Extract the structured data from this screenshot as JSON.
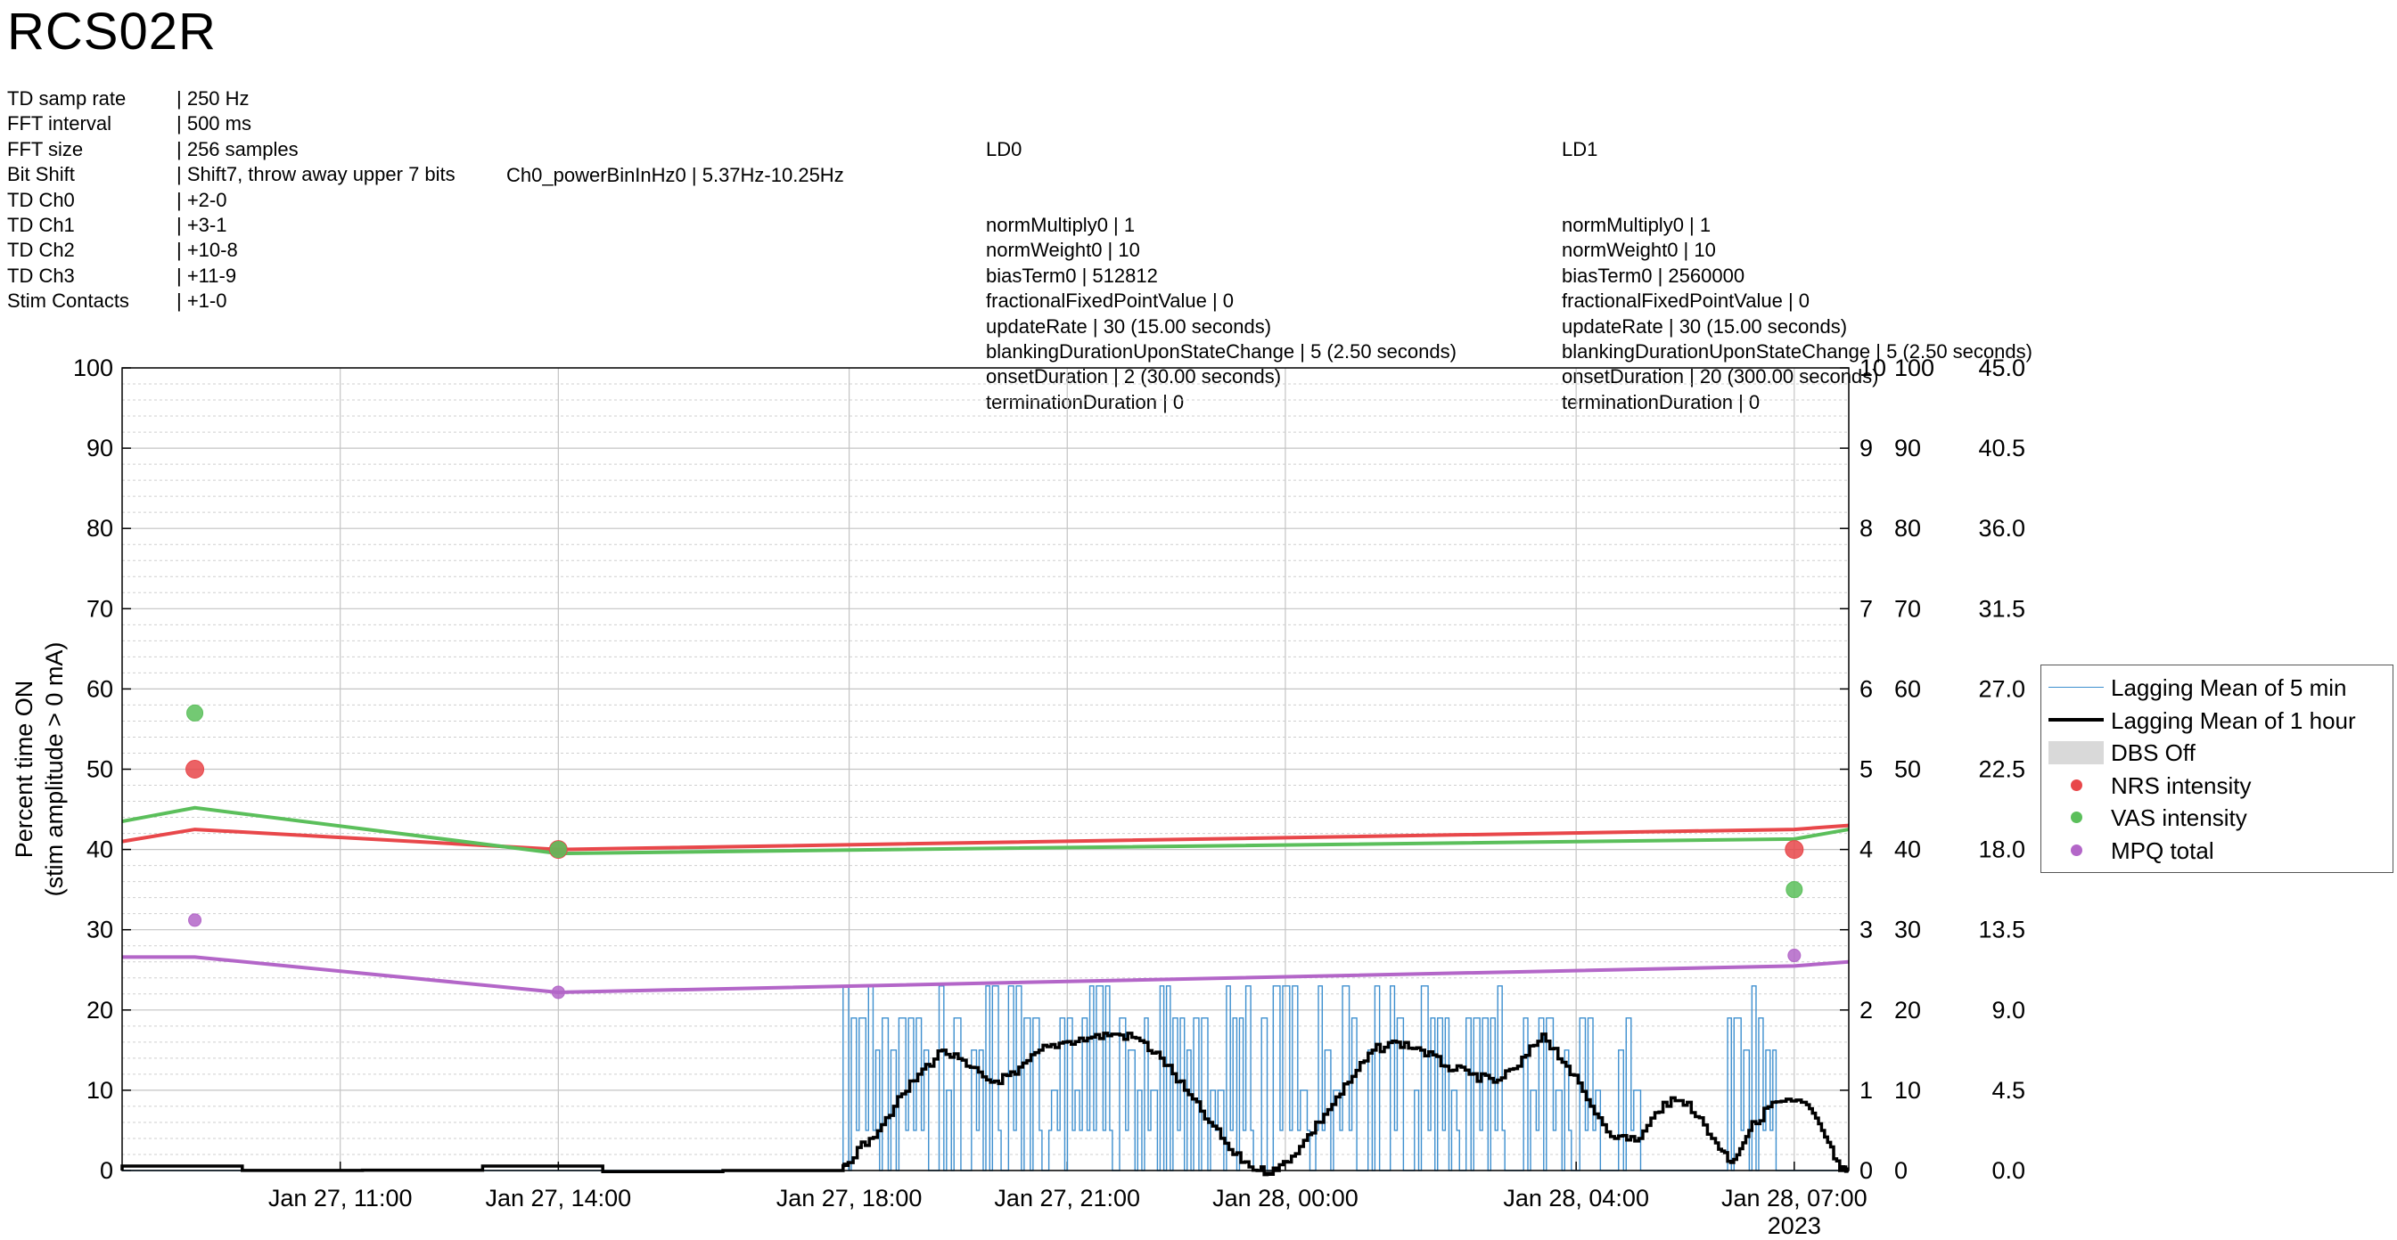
{
  "title": "RCS02R",
  "settings": [
    {
      "key": "TD samp rate",
      "value": "| 250 Hz"
    },
    {
      "key": "FFT interval",
      "value": "| 500 ms"
    },
    {
      "key": "FFT size",
      "value": "| 256 samples"
    },
    {
      "key": "Bit Shift",
      "value": "| Shift7, throw away upper 7 bits"
    },
    {
      "key": "TD Ch0",
      "value": "| +2-0"
    },
    {
      "key": "TD Ch1",
      "value": "| +3-1"
    },
    {
      "key": "TD Ch2",
      "value": "| +10-8"
    },
    {
      "key": "TD Ch3",
      "value": "| +11-9"
    },
    {
      "key": "Stim Contacts",
      "value": "| +1-0"
    }
  ],
  "powerbin": "Ch0_powerBinInHz0 | 5.37Hz-10.25Hz",
  "ld0": {
    "title": "LD0",
    "lines": [
      "normMultiply0 | 1",
      "normWeight0 | 10",
      "biasTerm0 | 512812",
      "fractionalFixedPointValue | 0",
      "updateRate | 30 (15.00 seconds)",
      "blankingDurationUponStateChange | 5 (2.50 seconds)",
      "onsetDuration | 2 (30.00 seconds)",
      "terminationDuration | 0"
    ]
  },
  "ld1": {
    "title": "LD1",
    "lines": [
      "normMultiply0 | 1",
      "normWeight0 | 10",
      "biasTerm0 | 2560000",
      "fractionalFixedPointValue | 0",
      "updateRate | 30 (15.00 seconds)",
      "blankingDurationUponStateChange | 5 (2.50 seconds)",
      "onsetDuration | 20 (300.00 seconds)",
      "terminationDuration | 0"
    ]
  },
  "chart_data": {
    "type": "line",
    "xlim": [
      "Jan 27, 08:00",
      "Jan 28, 07:45"
    ],
    "x_ticks": [
      {
        "label": "Jan 27, 11:00",
        "t": "11:00"
      },
      {
        "label": "Jan 27, 14:00",
        "t": "14:00"
      },
      {
        "label": "Jan 27, 18:00",
        "t": "18:00"
      },
      {
        "label": "Jan 27, 21:00",
        "t": "21:00"
      },
      {
        "label": "Jan 28, 00:00",
        "t": "24:00"
      },
      {
        "label": "Jan 28, 04:00",
        "t": "28:00"
      },
      {
        "label": "Jan 28, 07:00",
        "t": "31:00"
      }
    ],
    "x_year_label": "2023",
    "ylabel": [
      "Percent time ON",
      "(stim amplitude > 0 mA)"
    ],
    "ylim": [
      0,
      100
    ],
    "y_ticks": [
      0,
      10,
      20,
      30,
      40,
      50,
      60,
      70,
      80,
      90,
      100
    ],
    "right_axes": [
      {
        "ylim": [
          0,
          10
        ],
        "ticks": [
          "0",
          "1",
          "2",
          "3",
          "4",
          "5",
          "6",
          "7",
          "8",
          "9",
          "10"
        ]
      },
      {
        "ylim": [
          0,
          100
        ],
        "ticks": [
          "0",
          "10",
          "20",
          "30",
          "40",
          "50",
          "60",
          "70",
          "80",
          "90",
          "100"
        ]
      },
      {
        "ylim": [
          0,
          45
        ],
        "ticks": [
          "0.0",
          "4.5",
          "9.0",
          "13.5",
          "18.0",
          "22.5",
          "27.0",
          "31.5",
          "36.0",
          "40.5",
          "45.0"
        ]
      }
    ],
    "grid": "on",
    "legend_position": "outside-right",
    "legend": [
      {
        "label": "Lagging Mean of 5 min",
        "kind": "thin-line",
        "color": "#3d8fcf"
      },
      {
        "label": "Lagging Mean of 1 hour",
        "kind": "thick-line",
        "color": "#000000"
      },
      {
        "label": "DBS Off",
        "kind": "patch",
        "color": "#d9d9d9"
      },
      {
        "label": "NRS intensity",
        "kind": "dot",
        "color": "#e8474a"
      },
      {
        "label": "VAS intensity",
        "kind": "dot",
        "color": "#5bbf5b"
      },
      {
        "label": "MPQ total",
        "kind": "dot",
        "color": "#b366c8"
      }
    ],
    "series": [
      {
        "name": "NRS intensity",
        "axis": "right-1",
        "color": "#e8474a",
        "points": [
          {
            "x": "09:00",
            "y": 5.0
          },
          {
            "x": "14:00",
            "y": 4.0
          },
          {
            "x": "07:00",
            "y": 4.0
          }
        ],
        "trend": [
          {
            "x": "08:00",
            "y": 4.1
          },
          {
            "x": "09:00",
            "y": 4.25
          },
          {
            "x": "14:00",
            "y": 4.0
          },
          {
            "x": "07:00",
            "y": 4.25
          },
          {
            "x": "07:45",
            "y": 4.3
          }
        ]
      },
      {
        "name": "VAS intensity",
        "axis": "right-1",
        "color": "#5bbf5b",
        "points": [
          {
            "x": "09:00",
            "y": 5.7
          },
          {
            "x": "14:00",
            "y": 4.0
          },
          {
            "x": "07:00",
            "y": 3.5
          }
        ],
        "trend": [
          {
            "x": "08:00",
            "y": 4.35
          },
          {
            "x": "09:00",
            "y": 4.52
          },
          {
            "x": "14:00",
            "y": 3.95
          },
          {
            "x": "07:00",
            "y": 4.13
          },
          {
            "x": "07:45",
            "y": 4.25
          }
        ]
      },
      {
        "name": "MPQ total",
        "axis": "right-3",
        "color": "#b366c8",
        "points": [
          {
            "x": "09:00",
            "y": 14.04
          },
          {
            "x": "14:00",
            "y": 9.99
          },
          {
            "x": "07:00",
            "y": 12.06
          }
        ],
        "trend": [
          {
            "x": "08:00",
            "y": 11.97
          },
          {
            "x": "09:00",
            "y": 11.97
          },
          {
            "x": "14:00",
            "y": 9.99
          },
          {
            "x": "07:00",
            "y": 11.47
          },
          {
            "x": "07:45",
            "y": 11.7
          }
        ]
      }
    ],
    "stim_hour_mean": [
      {
        "x": "08:00",
        "y": 0
      },
      {
        "x": "17:55",
        "y": 0
      },
      {
        "x": "18:00",
        "y": 1
      },
      {
        "x": "18:20",
        "y": 4
      },
      {
        "x": "18:40",
        "y": 8
      },
      {
        "x": "19:00",
        "y": 12
      },
      {
        "x": "19:20",
        "y": 15
      },
      {
        "x": "19:40",
        "y": 13
      },
      {
        "x": "20:00",
        "y": 11
      },
      {
        "x": "20:20",
        "y": 12
      },
      {
        "x": "20:40",
        "y": 15
      },
      {
        "x": "21:00",
        "y": 16
      },
      {
        "x": "21:20",
        "y": 16.5
      },
      {
        "x": "21:40",
        "y": 17
      },
      {
        "x": "22:00",
        "y": 16.5
      },
      {
        "x": "22:20",
        "y": 14
      },
      {
        "x": "22:40",
        "y": 10
      },
      {
        "x": "23:00",
        "y": 6
      },
      {
        "x": "23:20",
        "y": 2
      },
      {
        "x": "23:40",
        "y": 0
      },
      {
        "x": "23:55",
        "y": 0
      },
      {
        "x": "24:15",
        "y": 3
      },
      {
        "x": "24:35",
        "y": 7
      },
      {
        "x": "24:55",
        "y": 11
      },
      {
        "x": "25:15",
        "y": 15
      },
      {
        "x": "25:35",
        "y": 16
      },
      {
        "x": "25:55",
        "y": 15
      },
      {
        "x": "26:15",
        "y": 13
      },
      {
        "x": "26:35",
        "y": 12
      },
      {
        "x": "26:55",
        "y": 11
      },
      {
        "x": "27:15",
        "y": 13
      },
      {
        "x": "27:35",
        "y": 17
      },
      {
        "x": "27:55",
        "y": 13
      },
      {
        "x": "28:15",
        "y": 8
      },
      {
        "x": "28:35",
        "y": 4
      },
      {
        "x": "28:55",
        "y": 4
      },
      {
        "x": "29:15",
        "y": 8.5
      },
      {
        "x": "29:35",
        "y": 8.5
      },
      {
        "x": "29:55",
        "y": 4
      },
      {
        "x": "30:10",
        "y": 1
      },
      {
        "x": "30:25",
        "y": 5
      },
      {
        "x": "30:45",
        "y": 8.5
      },
      {
        "x": "31:10",
        "y": 8.5
      },
      {
        "x": "31:25",
        "y": 5
      },
      {
        "x": "31:40",
        "y": 0
      },
      {
        "x": "31:45",
        "y": 0
      }
    ],
    "stim_5min_mean": {
      "levels": [
        0,
        5,
        10,
        15,
        19,
        23
      ],
      "active_windows": [
        {
          "start": "17:55",
          "end": "23:45"
        },
        {
          "start": "23:50",
          "end": "28:20"
        },
        {
          "start": "28:35",
          "end": "29:05"
        },
        {
          "start": "30:05",
          "end": "30:45"
        }
      ]
    }
  }
}
